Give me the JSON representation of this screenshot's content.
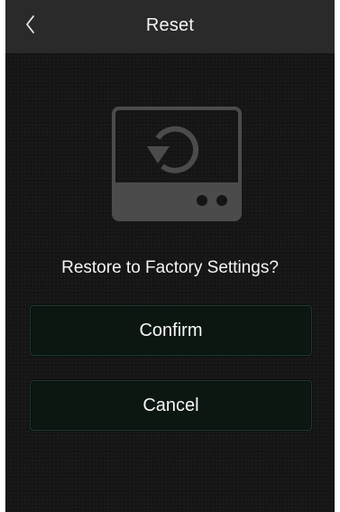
{
  "header": {
    "title": "Reset",
    "back_icon": "chevron-left-icon"
  },
  "main": {
    "illustration_icon": "restore-device-icon",
    "prompt": "Restore to Factory Settings?",
    "confirm_label": "Confirm",
    "cancel_label": "Cancel"
  },
  "colors": {
    "background": "#151515",
    "header": "#2a2a2a",
    "button": "#0c1712",
    "button_border": "#1e3b31",
    "text": "#f2f2f2",
    "icon": "#4b4b4b"
  }
}
